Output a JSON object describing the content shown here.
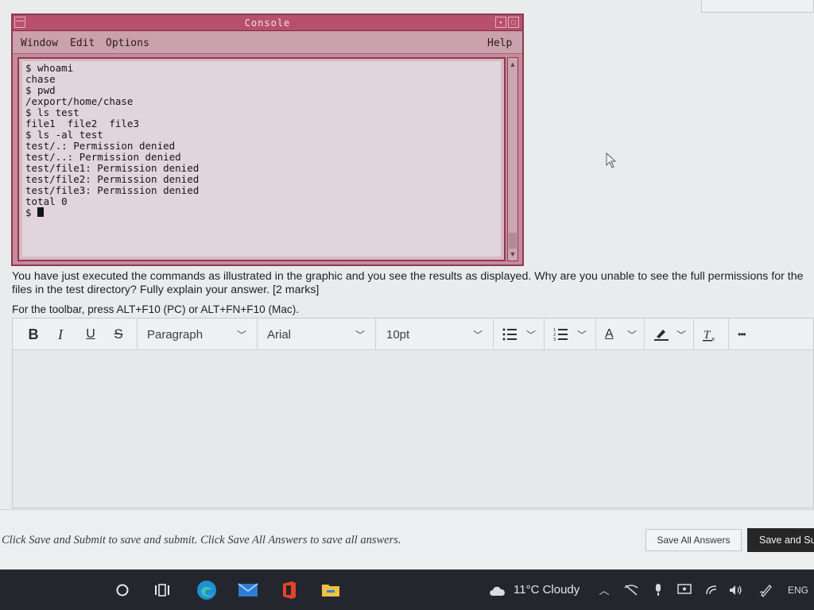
{
  "console": {
    "title": "Console",
    "menu": {
      "window": "Window",
      "edit": "Edit",
      "options": "Options",
      "help": "Help"
    },
    "lines": [
      "$ whoami",
      "chase",
      "$ pwd",
      "/export/home/chase",
      "$ ls test",
      "file1  file2  file3",
      "$ ls -al test",
      "test/.: Permission denied",
      "test/..: Permission denied",
      "test/file1: Permission denied",
      "test/file2: Permission denied",
      "test/file3: Permission denied",
      "total 0"
    ],
    "prompt": "$ "
  },
  "question": {
    "text": "You have just executed the commands as illustrated in the graphic and you see the results as displayed. Why are you unable to see the full permissions for the files in the test directory? Fully explain your answer.  [2 marks]",
    "hint": "For the toolbar, press ALT+F10 (PC) or ALT+FN+F10 (Mac)."
  },
  "toolbar": {
    "bold": "B",
    "italic": "I",
    "underline": "U",
    "strike": "S",
    "block_format": "Paragraph",
    "font": "Arial",
    "size": "10pt",
    "text_color": "A",
    "more": "•••"
  },
  "footer": {
    "note": "Click Save and Submit to save and submit. Click Save All Answers to save all answers.",
    "save_all": "Save All Answers",
    "save_submit": "Save and Submit"
  },
  "taskbar": {
    "weather": "11°C  Cloudy",
    "lang": "ENG"
  },
  "colors": {
    "console_title": "#b8506c",
    "console_border": "#8c3a52",
    "taskbar": "#23272d",
    "save_submit_bg": "#262626"
  }
}
